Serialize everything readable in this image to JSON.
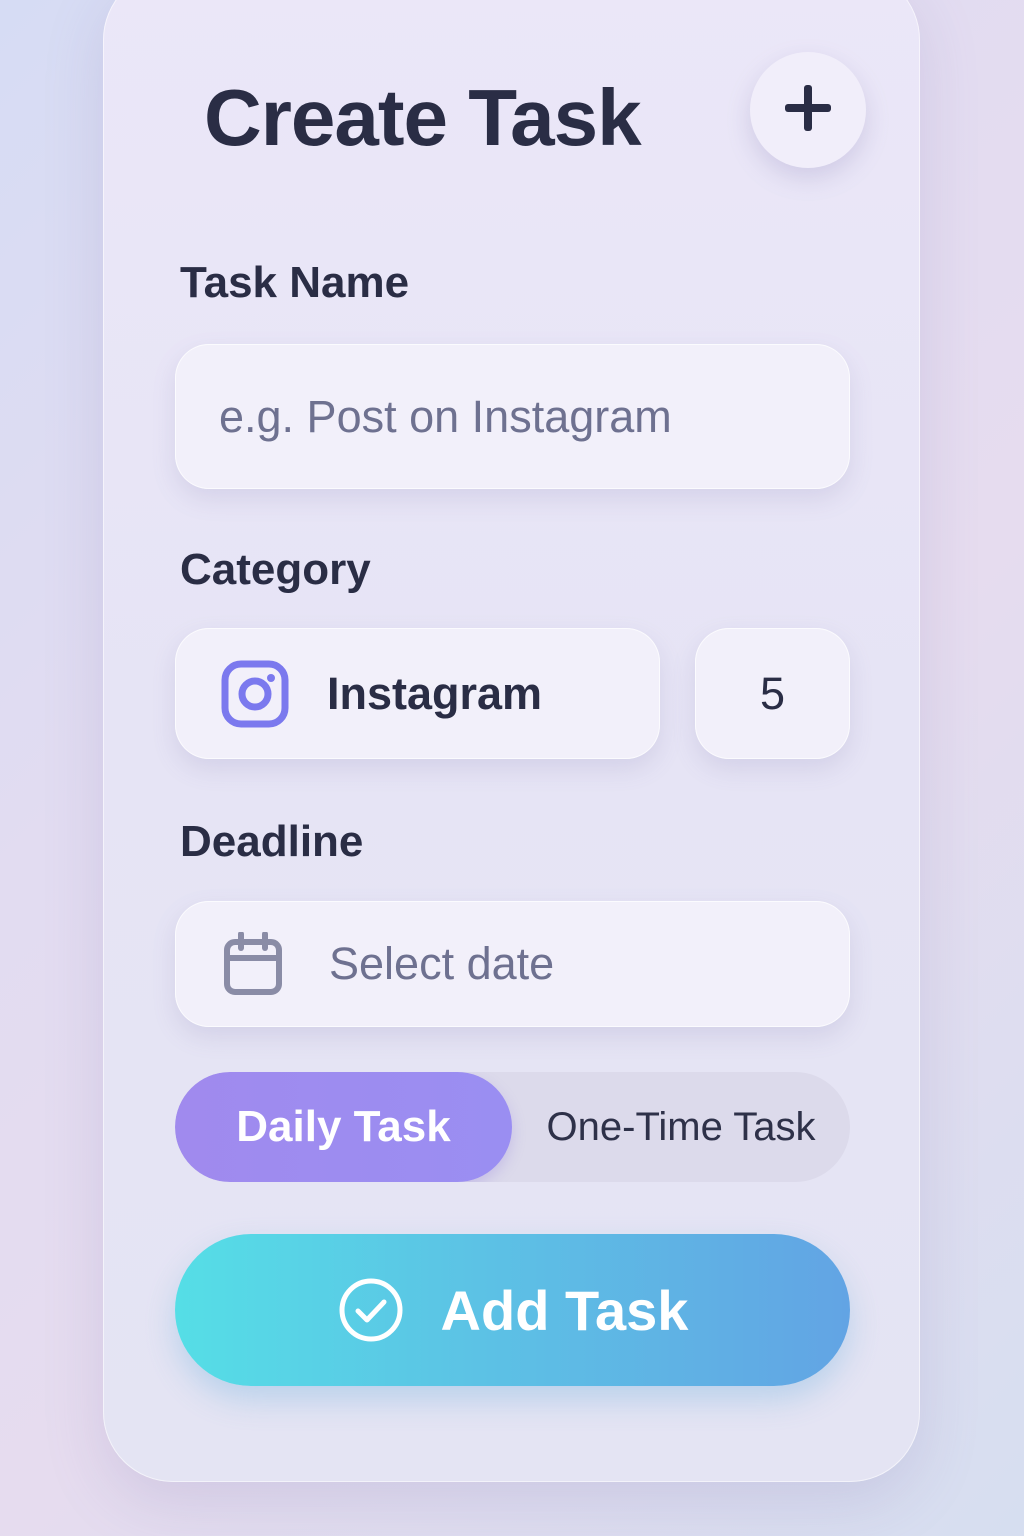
{
  "header": {
    "title": "Create Task",
    "add_icon": "plus-icon"
  },
  "form": {
    "task_name": {
      "label": "Task Name",
      "placeholder": "e.g. Post on Instagram"
    },
    "category": {
      "label": "Category",
      "selected": "Instagram",
      "icon": "instagram-icon",
      "count": "5"
    },
    "deadline": {
      "label": "Deadline",
      "placeholder": "Select date",
      "icon": "calendar-icon"
    },
    "task_type": {
      "options": [
        "Daily Task",
        "One-Time Task"
      ],
      "selected": "Daily Task"
    },
    "submit": {
      "label": "Add Task",
      "icon": "check-circle-icon"
    }
  },
  "colors": {
    "accent_purple": "#9a8ef2",
    "instagram_icon": "#7b79ee",
    "button_gradient_start": "#55dee6",
    "button_gradient_end": "#62a4e4",
    "text_dark": "#2a2d45"
  }
}
